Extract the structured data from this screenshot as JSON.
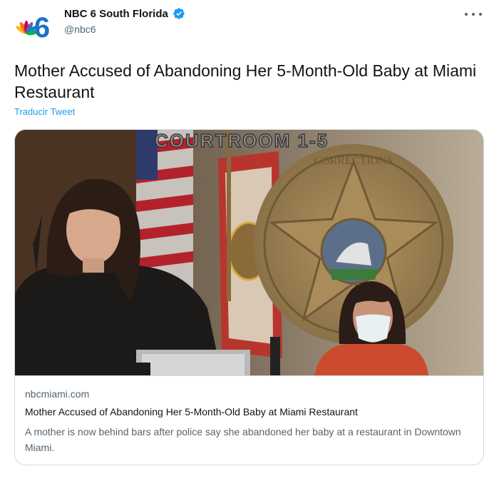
{
  "account": {
    "name": "NBC 6 South Florida",
    "handle": "@nbc6",
    "logo_numeral": "6",
    "verified_icon": "verified-badge-icon",
    "accent_color": "#1d9bf0"
  },
  "tweet": {
    "text": "Mother Accused of Abandoning Her 5-Month-Old Baby at Miami Restaurant",
    "translate_label": "Traducir Tweet"
  },
  "card": {
    "image_caption": "COURTROOM 1-5",
    "seal_text": "CORRECTIONS",
    "domain": "nbcmiami.com",
    "title": "Mother Accused of Abandoning Her 5-Month-Old Baby at Miami Restaurant",
    "description": "A mother is now behind bars after police say she abandoned her baby at a restaurant in Downtown Miami."
  }
}
